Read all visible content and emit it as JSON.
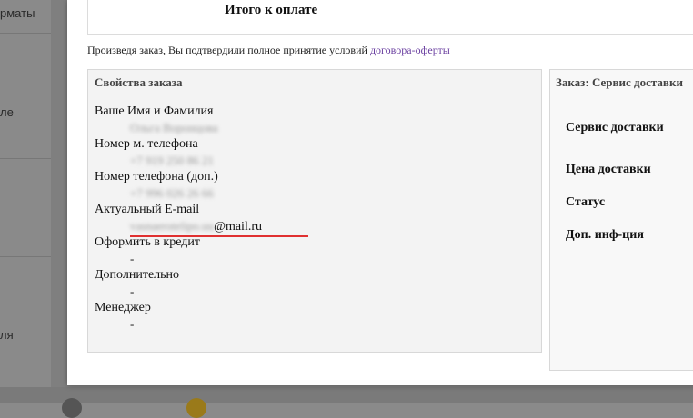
{
  "background": {
    "sidebar_items": [
      "рматы",
      "ле",
      "ля"
    ]
  },
  "summary": {
    "total_title": "Итого к оплате"
  },
  "agreement": {
    "text": "Произведя заказ, Вы подтвердили полное принятие условий ",
    "link": "договора-оферты"
  },
  "order_properties": {
    "title": "Свойства заказа",
    "fields": [
      {
        "label": "Ваше Имя и Фамилия",
        "value": "Ольга Воронцова"
      },
      {
        "label": "Номер м. телефона",
        "value": "+7 919 250 86 21"
      },
      {
        "label": "Номер телефона (доп.)",
        "value": "+7 996 026 26 66"
      },
      {
        "label": "Актуальный E-mail",
        "value_hidden": "vasnaerotelipo.uu",
        "value_visible": "@mail.ru"
      },
      {
        "label": "Оформить в кредит",
        "value": "-"
      },
      {
        "label": "Дополнительно",
        "value": "-"
      },
      {
        "label": "Менеджер",
        "value": "-"
      }
    ]
  },
  "delivery": {
    "title": "Заказ: Сервис доставки",
    "labels": [
      "Сервис доставки",
      "Цена доставки",
      "Статус",
      "Доп. инф-ция"
    ]
  }
}
